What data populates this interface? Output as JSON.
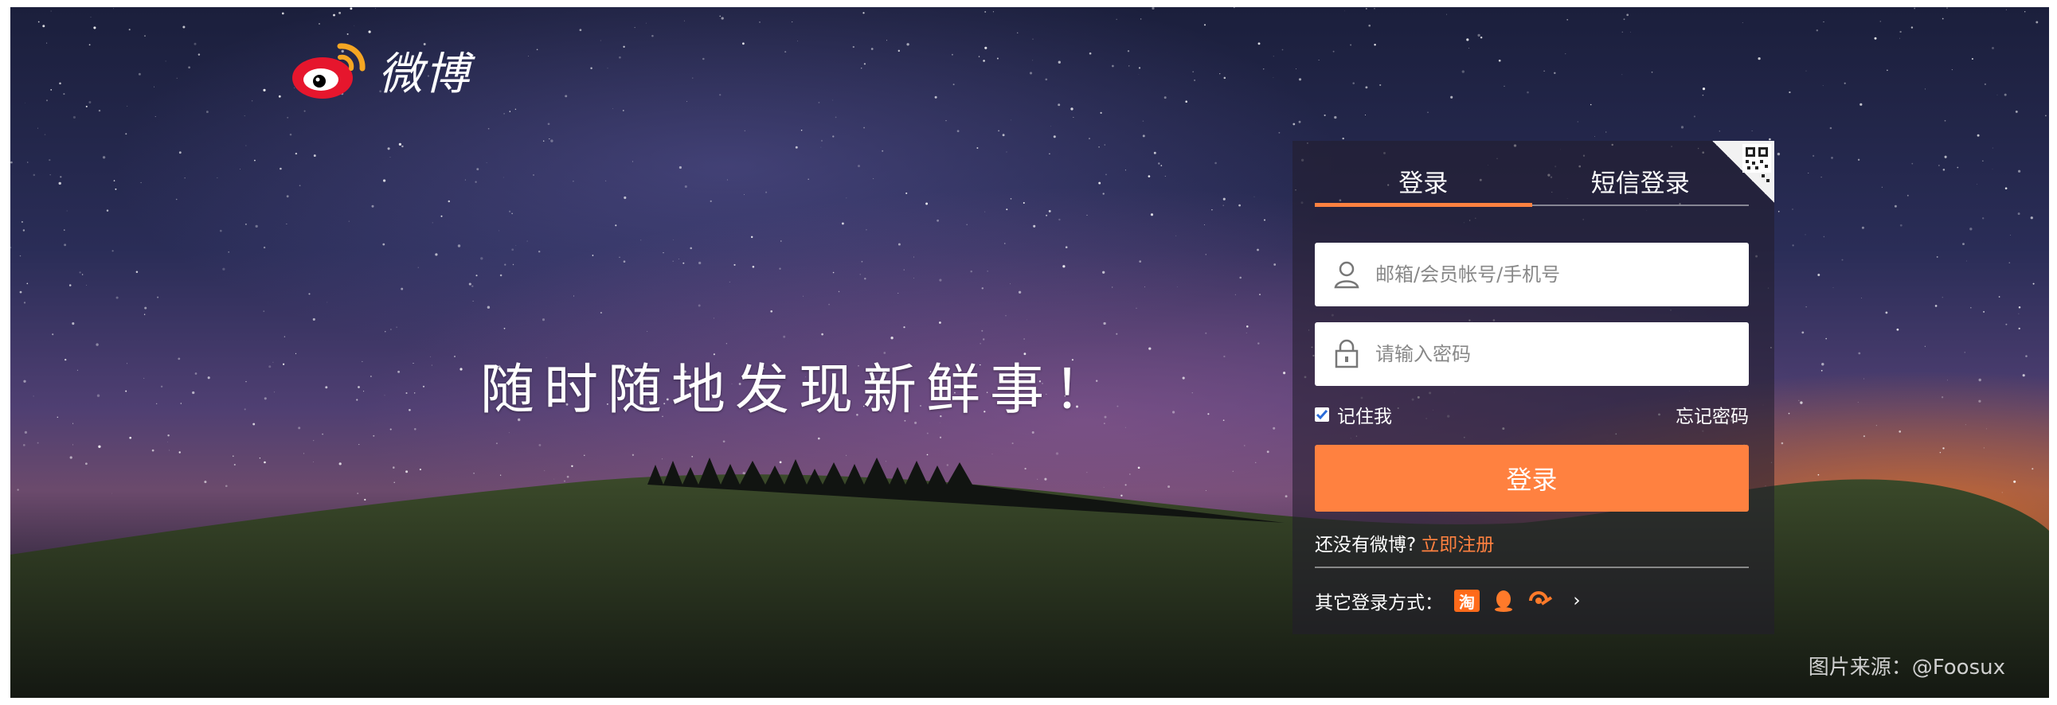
{
  "brand": {
    "logo_text": "微博",
    "accent": "#ff8140",
    "logo_red": "#e6162d"
  },
  "slogan": "随时随地发现新鲜事！",
  "credit": "图片来源：@Foosux",
  "login": {
    "tabs": [
      {
        "label": "登录",
        "active": true
      },
      {
        "label": "短信登录",
        "active": false
      }
    ],
    "username": {
      "placeholder": "邮箱/会员帐号/手机号",
      "value": "",
      "icon": "user-icon"
    },
    "password": {
      "placeholder": "请输入密码",
      "value": "",
      "icon": "lock-icon"
    },
    "remember_label": "记住我",
    "remember_checked": true,
    "forgot_label": "忘记密码",
    "submit_label": "登录",
    "register_prompt": "还没有微博?",
    "register_link": "立即注册",
    "other_methods_label": "其它登录方式：",
    "other_methods": [
      {
        "name": "taobao-icon",
        "text": "淘"
      },
      {
        "name": "qq-icon"
      },
      {
        "name": "tianyi-icon"
      }
    ],
    "more_symbol": "›"
  }
}
